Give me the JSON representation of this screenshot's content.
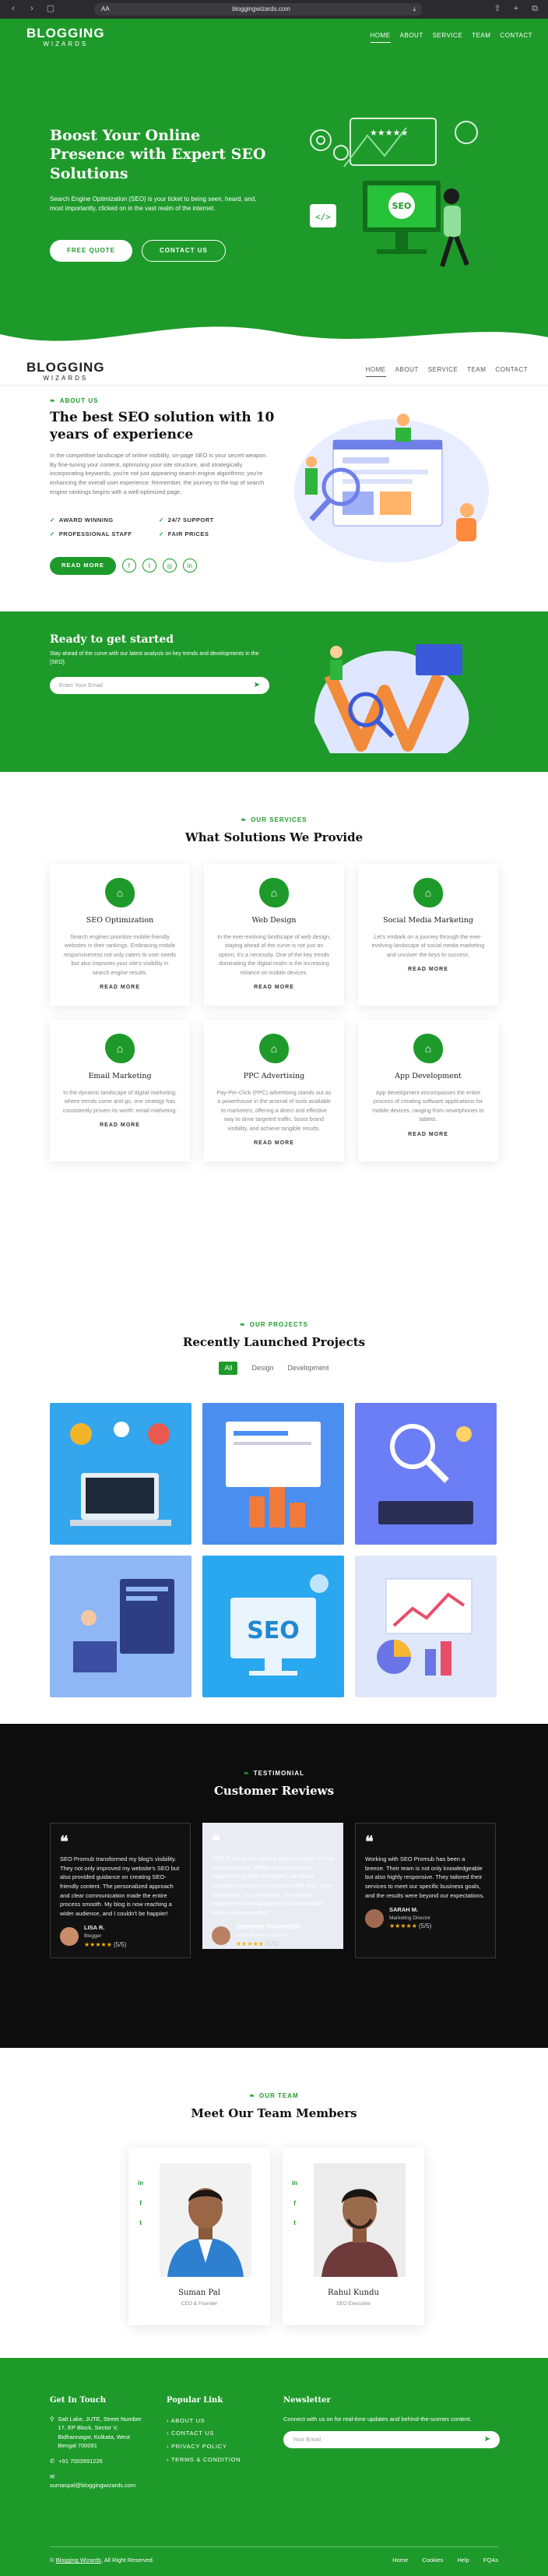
{
  "browser": {
    "tab_label": "AA",
    "url": "bloggingwizards.com"
  },
  "brand": {
    "name_top": "BLOGGING",
    "name_bottom": "WIZARDS",
    "primary_color": "#1e9a2a",
    "dark_color": "#0d0d0d"
  },
  "nav": {
    "items": [
      "HOME",
      "ABOUT",
      "SERVICE",
      "TEAM",
      "CONTACT"
    ],
    "active": "HOME"
  },
  "hero": {
    "title": "Boost Your Online Presence with Expert SEO Solutions",
    "text": "Search Engine Optimization (SEO) is your ticket to being seen, heard, and, most importantly, clicked on in the vast realm of the internet.",
    "btn_quote": "FREE QUOTE",
    "btn_contact": "CONTACT US",
    "illustration_word": "SEO",
    "illustration_stars": "★★★★★"
  },
  "about": {
    "kicker": "ABOUT US",
    "title": "The best SEO solution with 10 years of experience",
    "text": "In the competitive landscape of online visibility, on-page SEO is your secret weapon. By fine-tuning your content, optimizing your site structure, and strategically incorporating keywords, you're not just appearing search engine algorithms; you're enhancing the overall user experience. Remember, the journey to the top of search engine rankings begins with a well-optimized page.",
    "checks": [
      "AWARD WINNING",
      "24/7 SUPPORT",
      "PROFESSIONAL STAFF",
      "FAIR PRICES"
    ],
    "btn": "READ MORE",
    "socials": [
      "f",
      "t",
      "◎",
      "in"
    ]
  },
  "cta": {
    "title": "Ready to get started",
    "text": "Stay ahead of the curve with our latest analysis on key trends and developments in the [SEO].",
    "placeholder": "Enter Your Email"
  },
  "services": {
    "kicker": "OUR SERVICES",
    "title": "What Solutions We Provide",
    "read_more": "READ MORE",
    "items": [
      {
        "title": "SEO Optimization",
        "text": "Search engines prioritize mobile-friendly websites in their rankings. Embracing mobile responsiveness not only caters to user needs but also improves your site's visibility in search engine results."
      },
      {
        "title": "Web Design",
        "text": "In the ever-evolving landscape of web design, staying ahead of the curve is not just an option; it's a necessity. One of the key trends dominating the digital realm is the increasing reliance on mobile devices."
      },
      {
        "title": "Social Media Marketing",
        "text": "Let's embark on a journey through the ever-evolving landscape of social media marketing and uncover the keys to success."
      },
      {
        "title": "Email Marketing",
        "text": "In the dynamic landscape of digital marketing, where trends come and go, one strategy has consistently proven its worth: email marketing."
      },
      {
        "title": "PPC Advertising",
        "text": "Pay-Per-Click (PPC) advertising stands out as a powerhouse in the arsenal of tools available to marketers, offering a direct and effective way to drive targeted traffic, boost brand visibility, and achieve tangible results."
      },
      {
        "title": "App Development",
        "text": "App development encompasses the entire process of creating software applications for mobile devices, ranging from smartphones to tablets."
      }
    ]
  },
  "projects": {
    "kicker": "OUR PROJECTS",
    "title": "Recently Launched Projects",
    "filters": [
      "All",
      "Design",
      "Development"
    ],
    "active_filter": "All",
    "thumb_word": "SEO"
  },
  "reviews": {
    "kicker": "TESTIMONIAL",
    "title": "Customer Reviews",
    "items": [
      {
        "text": "SEO Promub transformed my blog's visibility. They not only improved my website's SEO but also provided guidance on creating SEO-friendly content. The personalized approach and clear communication made the entire process smooth. My blog is now reaching a wider audience, and I couldn't be happier!",
        "name": "LISA R.",
        "role": "Blogger",
        "stars": "★★★★★",
        "score": "(5/5)"
      },
      {
        "text": "SEO Promub has been a game-changer for my small business. Within a few months of implementing their strategies, we saw a significant increase in website traffic and, more importantly, in conversions. The team's expertise and dedication are commendable. Highly recommended!",
        "name": "JENNIFER THOMPSON",
        "role": "Small Business Owner",
        "stars": "★★★★★",
        "score": "(5/5)"
      },
      {
        "text": "Working with SEO Promub has been a breeze. Their team is not only knowledgeable but also highly responsive. They tailored their services to meet our specific business goals, and the results were beyond our expectations.",
        "name": "SARAH M.",
        "role": "Marketing Director",
        "stars": "★★★★★",
        "score": "(5/5)"
      }
    ]
  },
  "team": {
    "kicker": "OUR TEAM",
    "title": "Meet Our Team Members",
    "members": [
      {
        "name": "Suman Pal",
        "role": "CEO & Founder"
      },
      {
        "name": "Rahul Kundu",
        "role": "SEO Executive"
      }
    ]
  },
  "footer": {
    "touch_title": "Get In Touch",
    "address": "Salt Lake, JUTE, Street Number 17, EP Block, Sector V, Bidhannagar, Kolkata, West Bengal 700091",
    "phone": "+91 7003991226",
    "email": "sumanpal@bloggingwizards.com",
    "links_title": "Popular Link",
    "links": [
      "ABOUT US",
      "CONTACT US",
      "PRIVACY POLICY",
      "TERMS & CONDITION"
    ],
    "news_title": "Newsletter",
    "news_text": "Connect with us on for real-time updates and behind-the-scenes content.",
    "placeholder": "Your Email",
    "copyright_brand": "Blogging Wizards",
    "copyright_rest": ", All Right Reserved.",
    "bottom_links": [
      "Home",
      "Cookies",
      "Help",
      "FQAs"
    ]
  }
}
